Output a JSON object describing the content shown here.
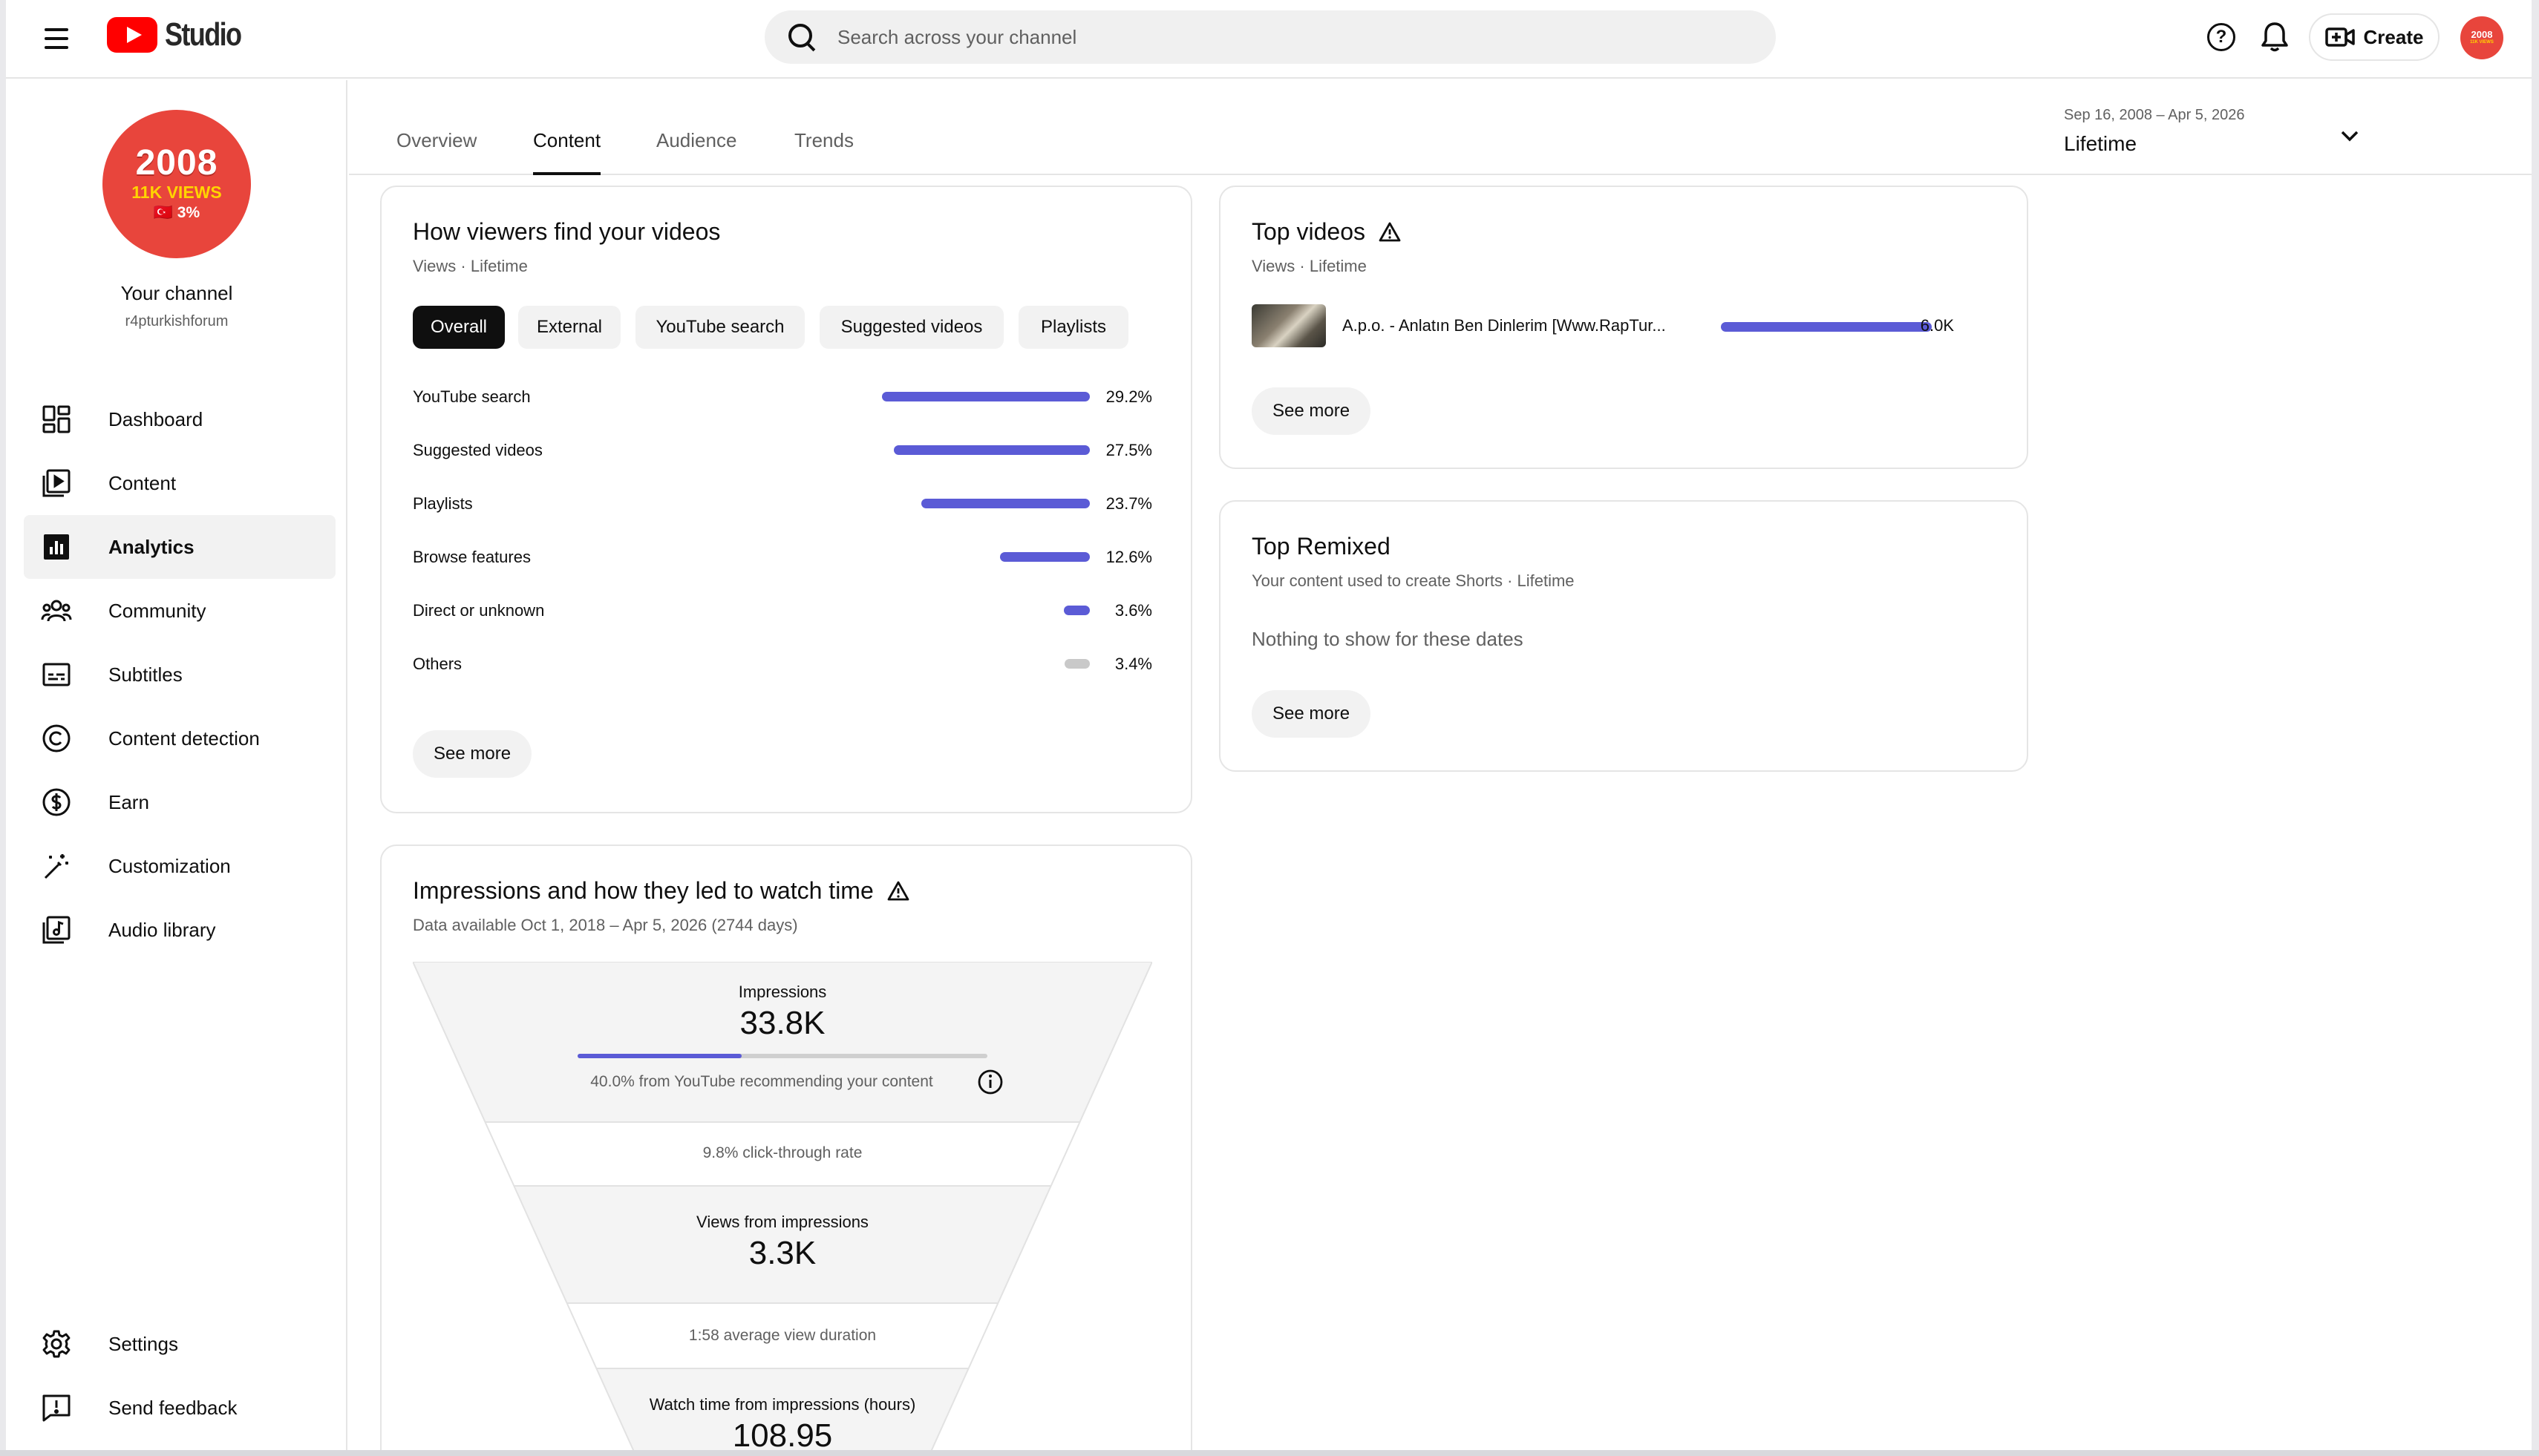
{
  "header": {
    "logo_text": "Studio",
    "search_placeholder": "Search across your channel",
    "create_label": "Create",
    "avatar_text": "2008",
    "avatar_sub": "11K VIEWS"
  },
  "sidebar": {
    "avatar": {
      "year": "2008",
      "views": "11K VIEWS",
      "pct": "🇹🇷 3%"
    },
    "channel_name": "Your channel",
    "channel_handle": "r4pturkishforum",
    "items": [
      {
        "label": "Dashboard",
        "icon": "dashboard-icon"
      },
      {
        "label": "Content",
        "icon": "content-icon"
      },
      {
        "label": "Analytics",
        "icon": "analytics-icon",
        "active": true
      },
      {
        "label": "Community",
        "icon": "community-icon"
      },
      {
        "label": "Subtitles",
        "icon": "subtitles-icon"
      },
      {
        "label": "Content detection",
        "icon": "copyright-icon"
      },
      {
        "label": "Earn",
        "icon": "dollar-icon"
      },
      {
        "label": "Customization",
        "icon": "magic-wand-icon"
      },
      {
        "label": "Audio library",
        "icon": "audio-library-icon"
      }
    ],
    "bottom_items": [
      {
        "label": "Settings",
        "icon": "gear-icon"
      },
      {
        "label": "Send feedback",
        "icon": "feedback-icon"
      }
    ]
  },
  "tabs": [
    {
      "label": "Overview"
    },
    {
      "label": "Content",
      "active": true
    },
    {
      "label": "Audience"
    },
    {
      "label": "Trends"
    }
  ],
  "date_picker": {
    "range": "Sep 16, 2008 – Apr 5, 2026",
    "label": "Lifetime"
  },
  "how_viewers_find": {
    "title": "How viewers find your videos",
    "subtitle": "Views · Lifetime",
    "chips": [
      "Overall",
      "External",
      "YouTube search",
      "Suggested videos",
      "Playlists"
    ],
    "active_chip": "Overall",
    "rows": [
      {
        "label": "YouTube search",
        "value": "29.2%",
        "fraction": 0.292
      },
      {
        "label": "Suggested videos",
        "value": "27.5%",
        "fraction": 0.275
      },
      {
        "label": "Playlists",
        "value": "23.7%",
        "fraction": 0.237
      },
      {
        "label": "Browse features",
        "value": "12.6%",
        "fraction": 0.126
      },
      {
        "label": "Direct or unknown",
        "value": "3.6%",
        "fraction": 0.036
      },
      {
        "label": "Others",
        "value": "3.4%",
        "fraction": 0.034,
        "grey": true
      }
    ],
    "see_more": "See more"
  },
  "impressions": {
    "title": "Impressions and how they led to watch time",
    "subtitle": "Data available Oct 1, 2018 – Apr 5, 2026 (2744 days)",
    "impressions_label": "Impressions",
    "impressions_value": "33.8K",
    "recommend_fraction": 0.4,
    "recommend_text": "40.0% from YouTube recommending your content",
    "ctr_text": "9.8% click-through rate",
    "views_label": "Views from impressions",
    "views_value": "3.3K",
    "avd_text": "1:58 average view duration",
    "watch_label": "Watch time from impressions (hours)",
    "watch_value": "108.95"
  },
  "top_videos": {
    "title": "Top videos",
    "subtitle": "Views · Lifetime",
    "items": [
      {
        "title": "A.p.o. - Anlatın Ben Dinlerim [Www.RapTur...",
        "value": "6.0K",
        "fraction": 1.0
      }
    ],
    "see_more": "See more"
  },
  "top_remixed": {
    "title": "Top Remixed",
    "subtitle": "Your content used to create Shorts · Lifetime",
    "empty_text": "Nothing to show for these dates",
    "see_more": "See more"
  },
  "colors": {
    "accent_bar": "#5b5bd6",
    "other_bar": "#c9c9c9",
    "logo_red": "#ff0000",
    "avatar_red": "#e8453c"
  }
}
